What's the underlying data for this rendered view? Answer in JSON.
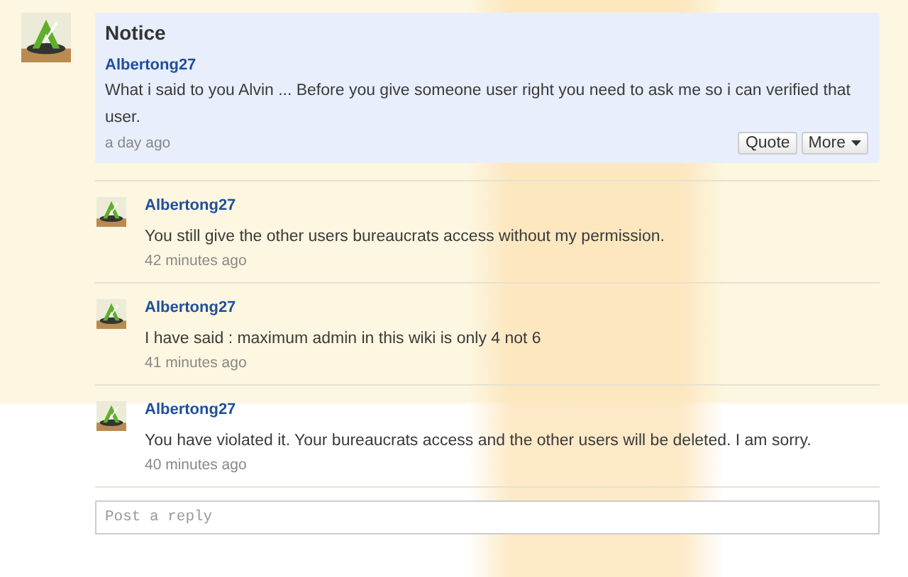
{
  "notice": {
    "title": "Notice",
    "author": "Albertong27",
    "text": "What i said to you Alvin ... Before you give someone user right you need to ask me so i can verified that user.",
    "time": "a day ago",
    "buttons": [
      {
        "label": "Quote",
        "kind": "plain"
      },
      {
        "label": "More",
        "kind": "menu"
      }
    ]
  },
  "replies": [
    {
      "author": "Albertong27",
      "text": "You still give the other users bureaucrats access without my permission.",
      "time": "42 minutes ago"
    },
    {
      "author": "Albertong27",
      "text": "I have said : maximum admin in this wiki is only 4 not 6",
      "time": "41 minutes ago"
    },
    {
      "author": "Albertong27",
      "text": "You have violated it. Your bureaucrats access and the other users will be deleted. I am sorry.",
      "time": "40 minutes ago"
    }
  ],
  "reply_field": {
    "placeholder": "Post a reply"
  }
}
